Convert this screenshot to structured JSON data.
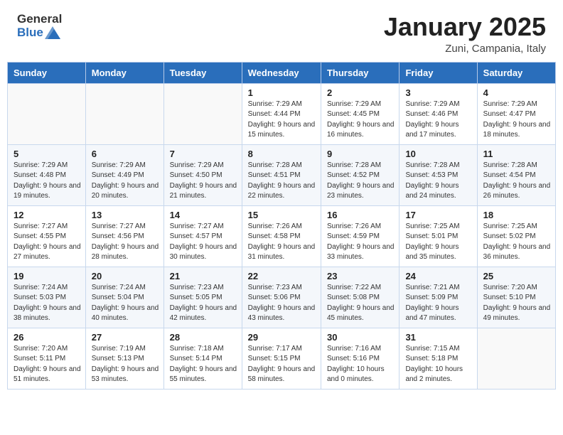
{
  "header": {
    "logo_general": "General",
    "logo_blue": "Blue",
    "month": "January 2025",
    "location": "Zuni, Campania, Italy"
  },
  "weekdays": [
    "Sunday",
    "Monday",
    "Tuesday",
    "Wednesday",
    "Thursday",
    "Friday",
    "Saturday"
  ],
  "weeks": [
    [
      {
        "day": "",
        "sunrise": "",
        "sunset": "",
        "daylight": ""
      },
      {
        "day": "",
        "sunrise": "",
        "sunset": "",
        "daylight": ""
      },
      {
        "day": "",
        "sunrise": "",
        "sunset": "",
        "daylight": ""
      },
      {
        "day": "1",
        "sunrise": "7:29 AM",
        "sunset": "4:44 PM",
        "daylight": "9 hours and 15 minutes."
      },
      {
        "day": "2",
        "sunrise": "7:29 AM",
        "sunset": "4:45 PM",
        "daylight": "9 hours and 16 minutes."
      },
      {
        "day": "3",
        "sunrise": "7:29 AM",
        "sunset": "4:46 PM",
        "daylight": "9 hours and 17 minutes."
      },
      {
        "day": "4",
        "sunrise": "7:29 AM",
        "sunset": "4:47 PM",
        "daylight": "9 hours and 18 minutes."
      }
    ],
    [
      {
        "day": "5",
        "sunrise": "7:29 AM",
        "sunset": "4:48 PM",
        "daylight": "9 hours and 19 minutes."
      },
      {
        "day": "6",
        "sunrise": "7:29 AM",
        "sunset": "4:49 PM",
        "daylight": "9 hours and 20 minutes."
      },
      {
        "day": "7",
        "sunrise": "7:29 AM",
        "sunset": "4:50 PM",
        "daylight": "9 hours and 21 minutes."
      },
      {
        "day": "8",
        "sunrise": "7:28 AM",
        "sunset": "4:51 PM",
        "daylight": "9 hours and 22 minutes."
      },
      {
        "day": "9",
        "sunrise": "7:28 AM",
        "sunset": "4:52 PM",
        "daylight": "9 hours and 23 minutes."
      },
      {
        "day": "10",
        "sunrise": "7:28 AM",
        "sunset": "4:53 PM",
        "daylight": "9 hours and 24 minutes."
      },
      {
        "day": "11",
        "sunrise": "7:28 AM",
        "sunset": "4:54 PM",
        "daylight": "9 hours and 26 minutes."
      }
    ],
    [
      {
        "day": "12",
        "sunrise": "7:27 AM",
        "sunset": "4:55 PM",
        "daylight": "9 hours and 27 minutes."
      },
      {
        "day": "13",
        "sunrise": "7:27 AM",
        "sunset": "4:56 PM",
        "daylight": "9 hours and 28 minutes."
      },
      {
        "day": "14",
        "sunrise": "7:27 AM",
        "sunset": "4:57 PM",
        "daylight": "9 hours and 30 minutes."
      },
      {
        "day": "15",
        "sunrise": "7:26 AM",
        "sunset": "4:58 PM",
        "daylight": "9 hours and 31 minutes."
      },
      {
        "day": "16",
        "sunrise": "7:26 AM",
        "sunset": "4:59 PM",
        "daylight": "9 hours and 33 minutes."
      },
      {
        "day": "17",
        "sunrise": "7:25 AM",
        "sunset": "5:01 PM",
        "daylight": "9 hours and 35 minutes."
      },
      {
        "day": "18",
        "sunrise": "7:25 AM",
        "sunset": "5:02 PM",
        "daylight": "9 hours and 36 minutes."
      }
    ],
    [
      {
        "day": "19",
        "sunrise": "7:24 AM",
        "sunset": "5:03 PM",
        "daylight": "9 hours and 38 minutes."
      },
      {
        "day": "20",
        "sunrise": "7:24 AM",
        "sunset": "5:04 PM",
        "daylight": "9 hours and 40 minutes."
      },
      {
        "day": "21",
        "sunrise": "7:23 AM",
        "sunset": "5:05 PM",
        "daylight": "9 hours and 42 minutes."
      },
      {
        "day": "22",
        "sunrise": "7:23 AM",
        "sunset": "5:06 PM",
        "daylight": "9 hours and 43 minutes."
      },
      {
        "day": "23",
        "sunrise": "7:22 AM",
        "sunset": "5:08 PM",
        "daylight": "9 hours and 45 minutes."
      },
      {
        "day": "24",
        "sunrise": "7:21 AM",
        "sunset": "5:09 PM",
        "daylight": "9 hours and 47 minutes."
      },
      {
        "day": "25",
        "sunrise": "7:20 AM",
        "sunset": "5:10 PM",
        "daylight": "9 hours and 49 minutes."
      }
    ],
    [
      {
        "day": "26",
        "sunrise": "7:20 AM",
        "sunset": "5:11 PM",
        "daylight": "9 hours and 51 minutes."
      },
      {
        "day": "27",
        "sunrise": "7:19 AM",
        "sunset": "5:13 PM",
        "daylight": "9 hours and 53 minutes."
      },
      {
        "day": "28",
        "sunrise": "7:18 AM",
        "sunset": "5:14 PM",
        "daylight": "9 hours and 55 minutes."
      },
      {
        "day": "29",
        "sunrise": "7:17 AM",
        "sunset": "5:15 PM",
        "daylight": "9 hours and 58 minutes."
      },
      {
        "day": "30",
        "sunrise": "7:16 AM",
        "sunset": "5:16 PM",
        "daylight": "10 hours and 0 minutes."
      },
      {
        "day": "31",
        "sunrise": "7:15 AM",
        "sunset": "5:18 PM",
        "daylight": "10 hours and 2 minutes."
      },
      {
        "day": "",
        "sunrise": "",
        "sunset": "",
        "daylight": ""
      }
    ]
  ]
}
